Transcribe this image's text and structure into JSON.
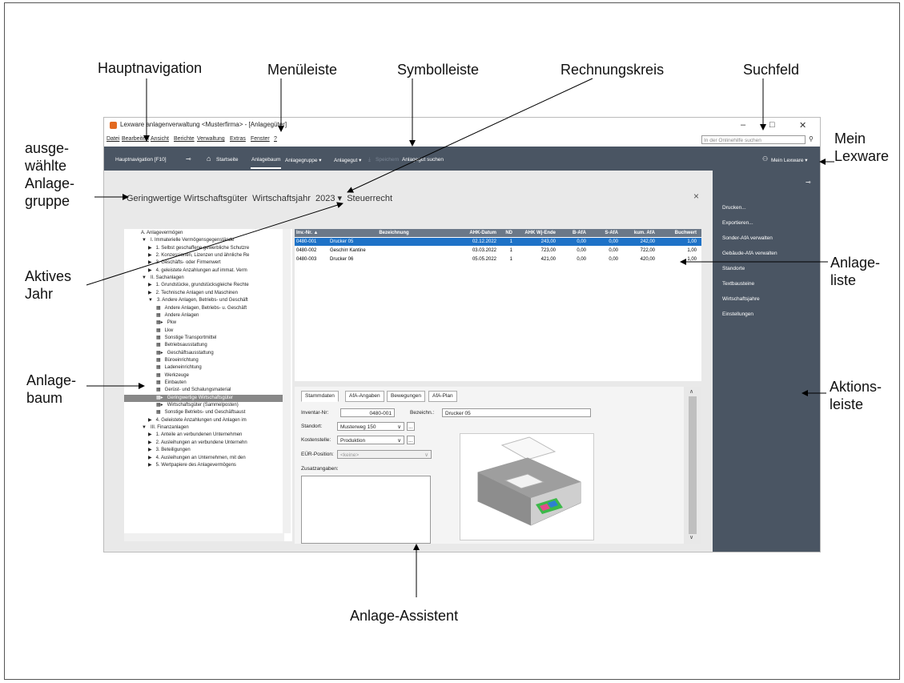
{
  "annotations": {
    "hauptnavigation": "Hauptnavigation",
    "menueleiste": "Menüleiste",
    "symbolleiste": "Symbolleiste",
    "rechnungskreis": "Rechnungskreis",
    "suchfeld": "Suchfeld",
    "mein_lexware": [
      "Mein",
      "Lexware"
    ],
    "ausgewaehlte_gruppe": [
      "ausge-",
      "wählte",
      "Anlage-",
      "gruppe"
    ],
    "aktives_jahr": [
      "Aktives",
      "Jahr"
    ],
    "anlagebaum": [
      "Anlage-",
      "baum"
    ],
    "anlageliste": [
      "Anlage-",
      "liste"
    ],
    "aktionsleiste": [
      "Aktions-",
      "leiste"
    ],
    "anlage_assistent": "Anlage-Assistent"
  },
  "window": {
    "title": "Lexware anlagenverwaltung <Musterfirma> - [Anlagegüter]",
    "controls": [
      "–",
      "□",
      "✕"
    ]
  },
  "menu": [
    "Datei",
    "Bearbeiten",
    "Ansicht",
    "Berichte",
    "Verwaltung",
    "Extras",
    "Fenster",
    "?"
  ],
  "search": {
    "placeholder": "In der Onlinehilfe suchen",
    "icon": "search-icon"
  },
  "toolbar": {
    "hauptnavigation": "Hauptnavigation [F10]",
    "pin": "⊸",
    "startseite": "Startseite",
    "anlagebaum": "Anlagebaum",
    "anlagegruppe": "Anlagegruppe ▾",
    "anlagegut": "Anlagegut ▾",
    "speichern": "Speichern",
    "anlagegut_suchen": "Anlagegut suchen",
    "mein_lexware": "Mein Lexware ▾"
  },
  "header": {
    "group": "Geringwertige Wirtschaftsgüter",
    "wj_label": "Wirtschaftsjahr",
    "year": "2023 ▾",
    "kreis": "Steuerrecht",
    "close": "×"
  },
  "tree": [
    {
      "label": "A. Anlagevermögen",
      "lvl": 0,
      "m": ""
    },
    {
      "label": "I. Immaterielle Vermögensgegenstände",
      "lvl": 1,
      "m": "▼"
    },
    {
      "label": "1. Selbst geschaffene gewerbliche Schutzre",
      "lvl": 2,
      "m": "▶"
    },
    {
      "label": "2. Konzessionen, Lizenzen und ähnliche Re",
      "lvl": 2,
      "m": "▶"
    },
    {
      "label": "3. Geschäfts- oder Firmenwert",
      "lvl": 2,
      "m": "▶"
    },
    {
      "label": "4. geleistete Anzahlungen auf immat. Verm",
      "lvl": 2,
      "m": "▶"
    },
    {
      "label": "II. Sachanlagen",
      "lvl": 1,
      "m": "▼"
    },
    {
      "label": "1. Grundstücke, grundstücksgleiche Rechte",
      "lvl": 2,
      "m": "▶"
    },
    {
      "label": "2. Technische Anlagen und Maschinen",
      "lvl": 2,
      "m": "▶"
    },
    {
      "label": "3. Andere Anlagen, Betriebs- und Geschäft",
      "lvl": 2,
      "m": "▼"
    },
    {
      "label": "Andere Anlagen, Betriebs- u. Geschäft",
      "lvl": 3,
      "m": "▦"
    },
    {
      "label": "Andere Anlagen",
      "lvl": 3,
      "m": "▦"
    },
    {
      "label": "Pkw",
      "lvl": 3,
      "m": "▦▸"
    },
    {
      "label": "Lkw",
      "lvl": 3,
      "m": "▦"
    },
    {
      "label": "Sonstige Transportmittel",
      "lvl": 3,
      "m": "▦"
    },
    {
      "label": "Betriebsausstattung",
      "lvl": 3,
      "m": "▦"
    },
    {
      "label": "Geschäftsausstattung",
      "lvl": 3,
      "m": "▦▸"
    },
    {
      "label": "Büroeinrichtung",
      "lvl": 3,
      "m": "▦"
    },
    {
      "label": "Ladeneinrichtung",
      "lvl": 3,
      "m": "▦"
    },
    {
      "label": "Werkzeuge",
      "lvl": 3,
      "m": "▦"
    },
    {
      "label": "Einbauten",
      "lvl": 3,
      "m": "▦"
    },
    {
      "label": "Gerüst- und Schalungsmaterial",
      "lvl": 3,
      "m": "▦"
    },
    {
      "label": "Geringwertige Wirtschaftsgüter",
      "lvl": 3,
      "m": "▦▸",
      "sel": true
    },
    {
      "label": "Wirtschaftsgüter (Sammelposten)",
      "lvl": 3,
      "m": "▦▸"
    },
    {
      "label": "Sonstige Betriebs- und Geschäftsaust",
      "lvl": 3,
      "m": "▦"
    },
    {
      "label": "4. Geleistete Anzahlungen und Anlagen im",
      "lvl": 2,
      "m": "▶"
    },
    {
      "label": "III. Finanzanlagen",
      "lvl": 1,
      "m": "▼"
    },
    {
      "label": "1. Anteile an verbundenen Unternehmen",
      "lvl": 2,
      "m": "▶"
    },
    {
      "label": "2. Ausleihungen an verbundene Unternehn",
      "lvl": 2,
      "m": "▶"
    },
    {
      "label": "3. Beteiligungen",
      "lvl": 2,
      "m": "▶"
    },
    {
      "label": "4. Ausleihungen an Unternehmen, mit den",
      "lvl": 2,
      "m": "▶"
    },
    {
      "label": "5. Wertpapiere des Anlagevermögens",
      "lvl": 2,
      "m": "▶"
    }
  ],
  "table": {
    "columns": [
      "Inv.-Nr. ▲",
      "Bezeichnung",
      "AHK-Datum",
      "ND",
      "AHK Wj-Ende",
      "B-AfA",
      "S-AfA",
      "kum. AfA",
      "Buchwert"
    ],
    "rows": [
      [
        "0480-001",
        "Drucker 05",
        "02.12.2022",
        "1",
        "243,00",
        "0,00",
        "0,00",
        "242,00",
        "1,00"
      ],
      [
        "0480-002",
        "Geschirr Kantine",
        "03.03.2022",
        "1",
        "723,00",
        "0,00",
        "0,00",
        "722,00",
        "1,00"
      ],
      [
        "0480-003",
        "Drucker 06",
        "05.05.2022",
        "1",
        "421,00",
        "0,00",
        "0,00",
        "420,00",
        "1,00"
      ]
    ]
  },
  "assistant": {
    "tabs": [
      "Stammdaten",
      "AfA-Angaben",
      "Bewegungen",
      "AfA-Plan"
    ],
    "inventar_label": "Inventar-Nr:",
    "inventar_value": "0480-001",
    "bezeichn_label": "Bezeichn.:",
    "bezeichn_value": "Drucker 05",
    "standort_label": "Standort:",
    "standort_value": "Musterweg 150",
    "kostenstelle_label": "Kostenstelle:",
    "kostenstelle_value": "Produktion",
    "eur_label": "EÜR-Position:",
    "eur_value": "<keine>",
    "zusatz_label": "Zusatzangaben:",
    "more_btn": "..."
  },
  "actions": [
    "Drucken...",
    "Exportieren...",
    "Sonder-AfA verwalten",
    "Gebäude-AfA verwalten",
    "Standorte",
    "Textbausteine",
    "Wirtschaftsjahre",
    "Einstellungen"
  ],
  "colors": {
    "toolbar": "#4a5563",
    "selection": "#1e72c7",
    "table_header": "#6b7888",
    "logo": "#e36a21"
  }
}
